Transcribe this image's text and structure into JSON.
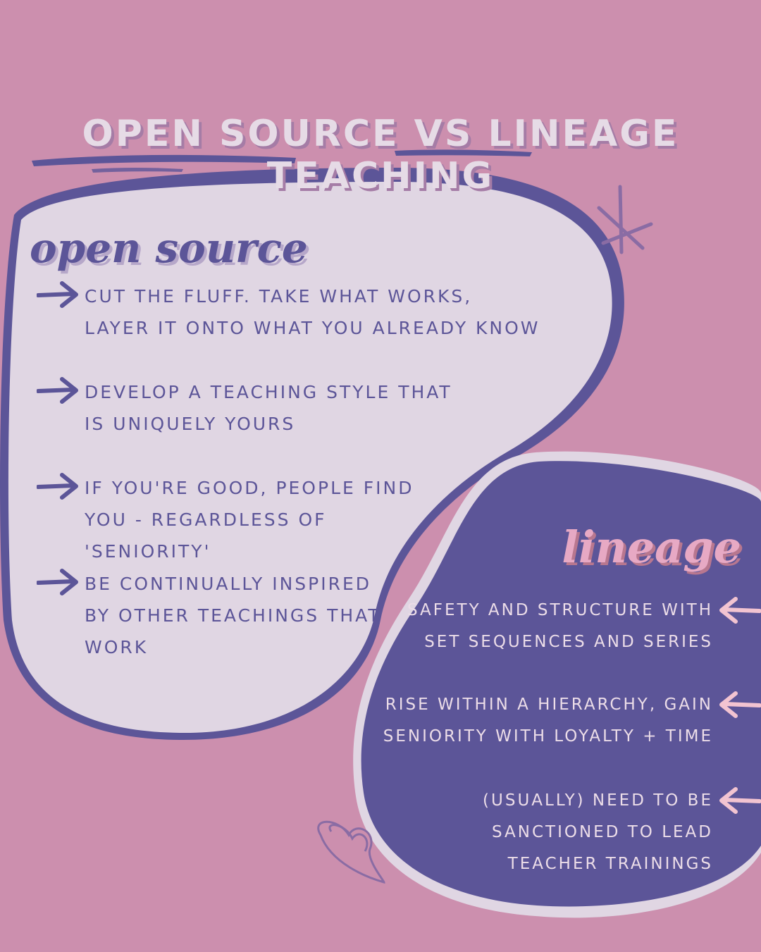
{
  "title": "OPEN SOURCE VS LINEAGE TEACHING",
  "open_source": {
    "heading": "open source",
    "items": [
      "CUT THE FLUFF. TAKE WHAT WORKS, LAYER IT ONTO WHAT YOU ALREADY KNOW",
      "DEVELOP A TEACHING STYLE THAT IS UNIQUELY YOURS",
      "IF YOU'RE GOOD, PEOPLE FIND YOU - REGARDLESS OF 'SENIORITY'",
      "BE CONTINUALLY INSPIRED BY OTHER TEACHINGS THAT WORK"
    ]
  },
  "lineage": {
    "heading": "lineage",
    "items": [
      "SAFETY AND STRUCTURE WITH SET SEQUENCES AND SERIES",
      "RISE WITHIN A HIERARCHY, GAIN SENIORITY WITH LOYALTY + TIME",
      "(USUALLY) NEED TO BE SANCTIONED TO LEAD TEACHER TRAININGS"
    ]
  },
  "colors": {
    "background": "#cc8fae",
    "light_blob": "#e0d6e3",
    "dark_blob": "#5c5598",
    "accent_pink": "#f2c4d1"
  },
  "icons": [
    "arrow-right-icon",
    "arrow-left-icon",
    "sparkle-icon",
    "heart-doodle-icon",
    "brush-stroke"
  ]
}
